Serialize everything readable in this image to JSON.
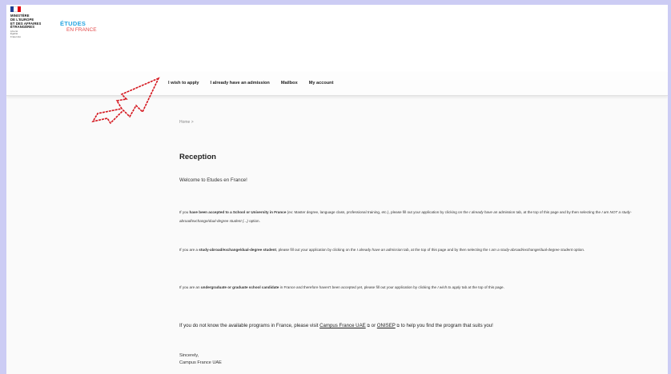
{
  "header": {
    "flag_colors": [
      "#1f3e93",
      "#ffffff",
      "#e1000f"
    ],
    "ministry_lines": [
      "MINISTÈRE",
      "DE L'EUROPE",
      "ET DES AFFAIRES",
      "ÉTRANGÈRES"
    ],
    "motto_lines": [
      "Liberté",
      "Égalité",
      "Fraternité"
    ],
    "etudes_top": "ÉTUDES",
    "etudes_bottom": "EN FRANCE"
  },
  "nav": {
    "items": [
      "I wish to apply",
      "I already have an admission",
      "Mailbox",
      "My account"
    ]
  },
  "annotation": {
    "arrow_color": "#d4141c"
  },
  "content": {
    "breadcrumb": "Home  >",
    "title": "Reception",
    "welcome": "Welcome to Etudes en France!",
    "p1": {
      "a": "If you ",
      "b": "have been accepted to a School or University in France",
      "c": " (ex: Master degree, language class, professional training, etc.), please fill out your application by clicking on the ",
      "d": "I already have an",
      "e": " admission tab, at the top of this page and by then selecting the ",
      "f": "I am NOT a study-abroad/exchange/dual-degree student (...)",
      "g": " option."
    },
    "p2": {
      "a": "If you are a ",
      "b": "study-abroad/exchange/dual-degree student",
      "c": ", please fill out your application by clicking on the ",
      "d": "I already have an admission",
      "e": " tab, at the top of this page and by then selecting the ",
      "f": "I am a study-abroad/exchange/dual-degree student",
      "g": " option."
    },
    "p3": {
      "a": "If you are an ",
      "b": "undergraduate or graduate school candidate",
      "c": " in France and therefore haven't been accepted yet, please fill out your application by clicking the ",
      "d": "I wish to apply",
      "e": " tab at the top of this page."
    },
    "p4": {
      "a": "If you do not know the available programs in France, please visit ",
      "link1": "Campus France UAE",
      "b": " or ",
      "link2": "ONISEP",
      "c": " to help you find the program that suits you!",
      "ext_icon": "⧉"
    },
    "sign": {
      "line1": "Sincerely,",
      "line2": "Campus France UAE"
    }
  }
}
